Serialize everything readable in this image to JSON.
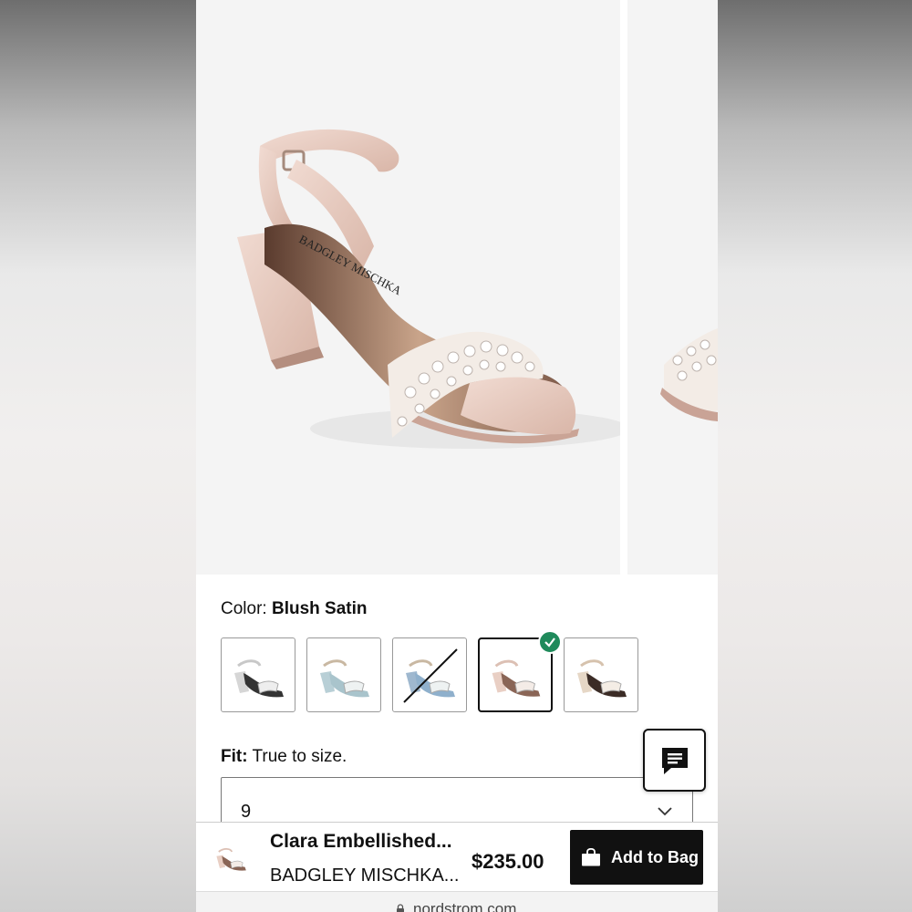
{
  "product_image": {
    "brand_printed_on_insole": "BADGLEY MISCHKA"
  },
  "color_selector": {
    "label": "Color:",
    "selected_color": "Blush Satin",
    "swatches": [
      {
        "icon": "sandal-silver",
        "available": true,
        "selected": false
      },
      {
        "icon": "sandal-light-blue",
        "available": true,
        "selected": false
      },
      {
        "icon": "sandal-blue",
        "available": false,
        "selected": false
      },
      {
        "icon": "sandal-blush",
        "available": true,
        "selected": true
      },
      {
        "icon": "sandal-champagne",
        "available": true,
        "selected": false
      }
    ]
  },
  "fit": {
    "label": "Fit:",
    "value": "True to size."
  },
  "size_select": {
    "value": "9"
  },
  "sticky_bar": {
    "product_name": "Clara Embellished...",
    "brand": "BADGLEY MISCHKA...",
    "price": "$235.00",
    "add_to_bag_label": "Add to Bag"
  },
  "browser": {
    "url": "nordstrom.com"
  },
  "colors": {
    "accent_check": "#1f8a5b",
    "button_bg": "#111111",
    "blush": "#e9cfc4"
  }
}
